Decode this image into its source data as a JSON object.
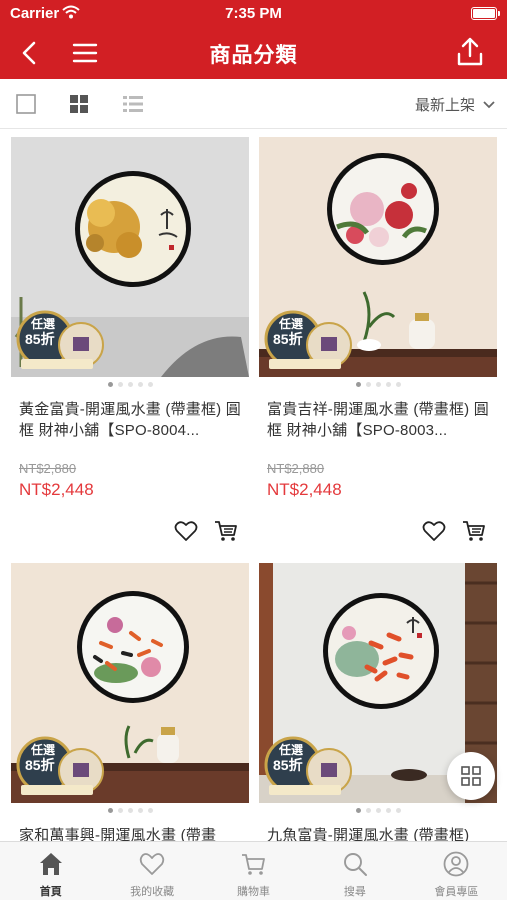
{
  "status_bar": {
    "carrier": "Carrier",
    "time": "7:35 PM"
  },
  "nav": {
    "title": "商品分類"
  },
  "toolbar": {
    "sort_label": "最新上架"
  },
  "products": [
    {
      "name": "黃金富貴-開運風水畫 (帶畫框) 圓框 財神小舖【SPO-8004...",
      "original_price": "NT$2,880",
      "price": "NT$2,448",
      "badge_top": "任選",
      "badge_pct": "85折"
    },
    {
      "name": "富貴吉祥-開運風水畫 (帶畫框) 圓框 財神小舖【SPO-8003...",
      "original_price": "NT$2,880",
      "price": "NT$2,448",
      "badge_top": "任選",
      "badge_pct": "85折"
    },
    {
      "name": "家和萬事興-開運風水畫 (帶畫",
      "original_price": "",
      "price": "",
      "badge_top": "任選",
      "badge_pct": "85折"
    },
    {
      "name": "九魚富貴-開運風水畫 (帶畫框)",
      "original_price": "",
      "price": "",
      "badge_top": "任選",
      "badge_pct": "85折"
    }
  ],
  "tabbar": [
    {
      "label": "首頁"
    },
    {
      "label": "我的收藏"
    },
    {
      "label": "購物車"
    },
    {
      "label": "搜尋"
    },
    {
      "label": "會員專區"
    }
  ],
  "colors": {
    "brand": "#d21f24",
    "price": "#e4393c"
  }
}
